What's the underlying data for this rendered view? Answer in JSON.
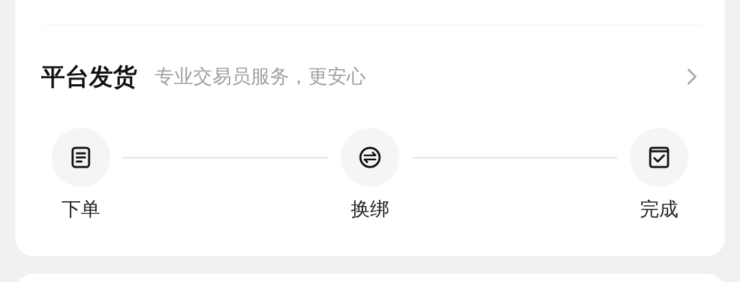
{
  "section": {
    "title": "平台发货",
    "subtitle": "专业交易员服务，更安心"
  },
  "steps": [
    {
      "label": "下单",
      "kind": "order"
    },
    {
      "label": "换绑",
      "kind": "swap"
    },
    {
      "label": "完成",
      "kind": "done"
    }
  ]
}
